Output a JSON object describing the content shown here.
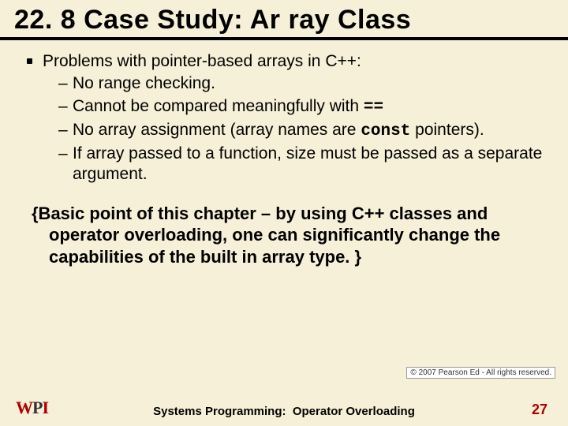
{
  "title": "22. 8 Case Study: Ar ray Class",
  "content": {
    "lead": "Problems with pointer-based arrays in C++:",
    "subs": {
      "a": "No range checking.",
      "b_pre": "Cannot be compared meaningfully with ",
      "b_code": "==",
      "c_pre": "No array assignment (array names are ",
      "c_code": "const",
      "c_post": " pointers).",
      "d": "If array passed to a function, size must be passed as a separate argument."
    }
  },
  "summary": "{Basic point of this chapter – by using C++ classes and operator overloading, one can significantly change the capabilities of the built in array type. }",
  "copyright": "© 2007 Pearson Ed - All rights reserved.",
  "footer": {
    "label": "Systems Programming:",
    "topic": "Operator Overloading"
  },
  "page": "27",
  "logo": {
    "w": "W",
    "p": "P",
    "i": "I"
  }
}
